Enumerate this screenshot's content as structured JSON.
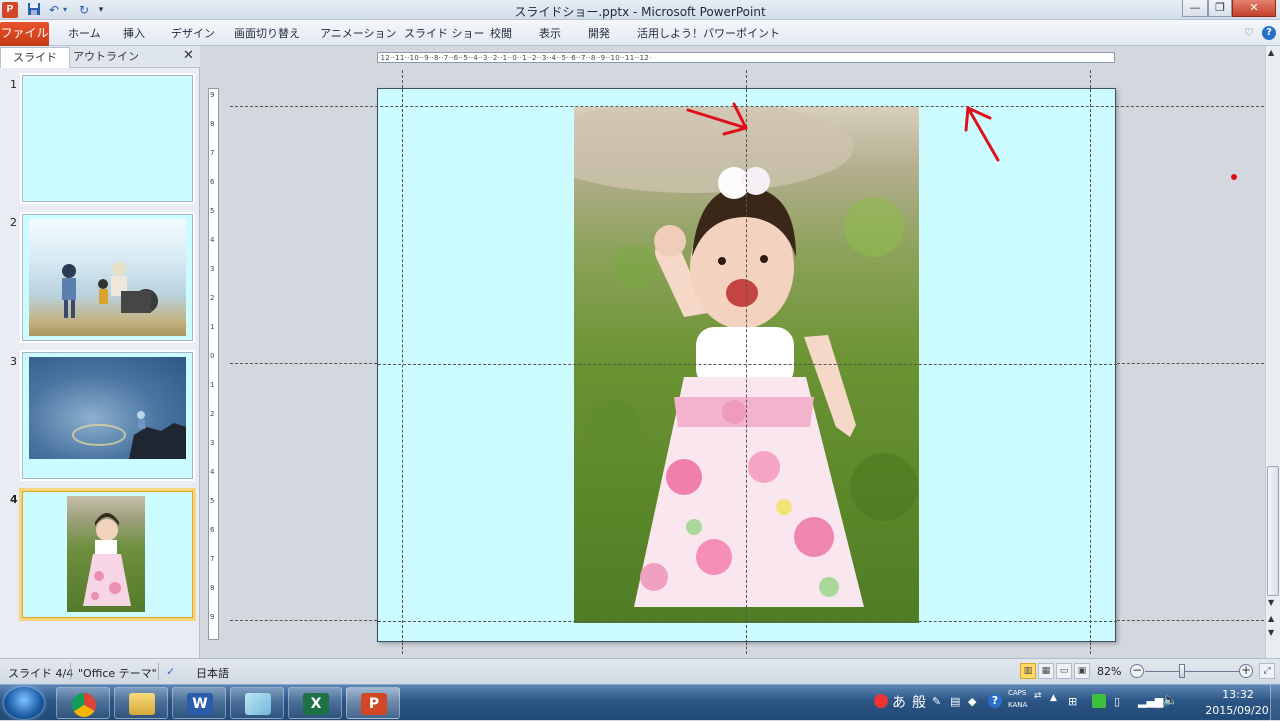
{
  "window": {
    "title": "スライドショー.pptx - Microsoft PowerPoint",
    "app_icon_letter": "P",
    "minimize": "—",
    "restore": "❐",
    "close": "✕"
  },
  "quick_access": {
    "save_icon": "save-icon",
    "undo_icon": "undo-icon",
    "redo_icon": "redo-icon",
    "customize": "▾"
  },
  "ribbon": {
    "file_tab": "ファイル",
    "tabs": [
      "ホーム",
      "挿入",
      "デザイン",
      "画面切り替え",
      "アニメーション",
      "スライド ショー",
      "校閲",
      "表示",
      "開発",
      "活用しよう！パワーポイント"
    ],
    "help": "?",
    "minimize_ribbon": "♡"
  },
  "left_pane": {
    "tabs": {
      "slides": "スライド",
      "outline": "アウトライン"
    },
    "close": "✕",
    "slides": [
      {
        "number": "1",
        "content": "blank"
      },
      {
        "number": "2",
        "content": "photo-children-at-waterfall"
      },
      {
        "number": "3",
        "content": "photo-sky-halo"
      },
      {
        "number": "4",
        "content": "photo-girl-in-field",
        "selected": true
      }
    ]
  },
  "rulers": {
    "horizontal": "·12··11··10··9··8··7··6··5··4··3··2··1··0··1··2··3··4··5··6··7··8··9··10··11··12·",
    "vertical": [
      "9",
      "8",
      "7",
      "6",
      "5",
      "4",
      "3",
      "2",
      "1",
      "0",
      "1",
      "2",
      "3",
      "4",
      "5",
      "6",
      "7",
      "8",
      "9"
    ]
  },
  "slide": {
    "background_color": "#ccfcff",
    "photo": "photo-girl-in-field"
  },
  "status_bar": {
    "slide_indicator": "スライド 4/4",
    "theme": "\"Office テーマ\"",
    "language": "日本語",
    "zoom": "82%",
    "zoom_minus": "−",
    "zoom_plus": "+"
  },
  "taskbar": {
    "apps": [
      "chrome",
      "explorer",
      "word",
      "notepad",
      "excel",
      "powerpoint"
    ],
    "ime": [
      "あ",
      "般"
    ],
    "caps": "CAPS",
    "kana": "KANA",
    "time": "13:32",
    "date": "2015/09/20"
  },
  "colors": {
    "accent_file_tab": "#c43b17",
    "slide_bg": "#ccfcff",
    "annotation_red": "#e0101a"
  }
}
